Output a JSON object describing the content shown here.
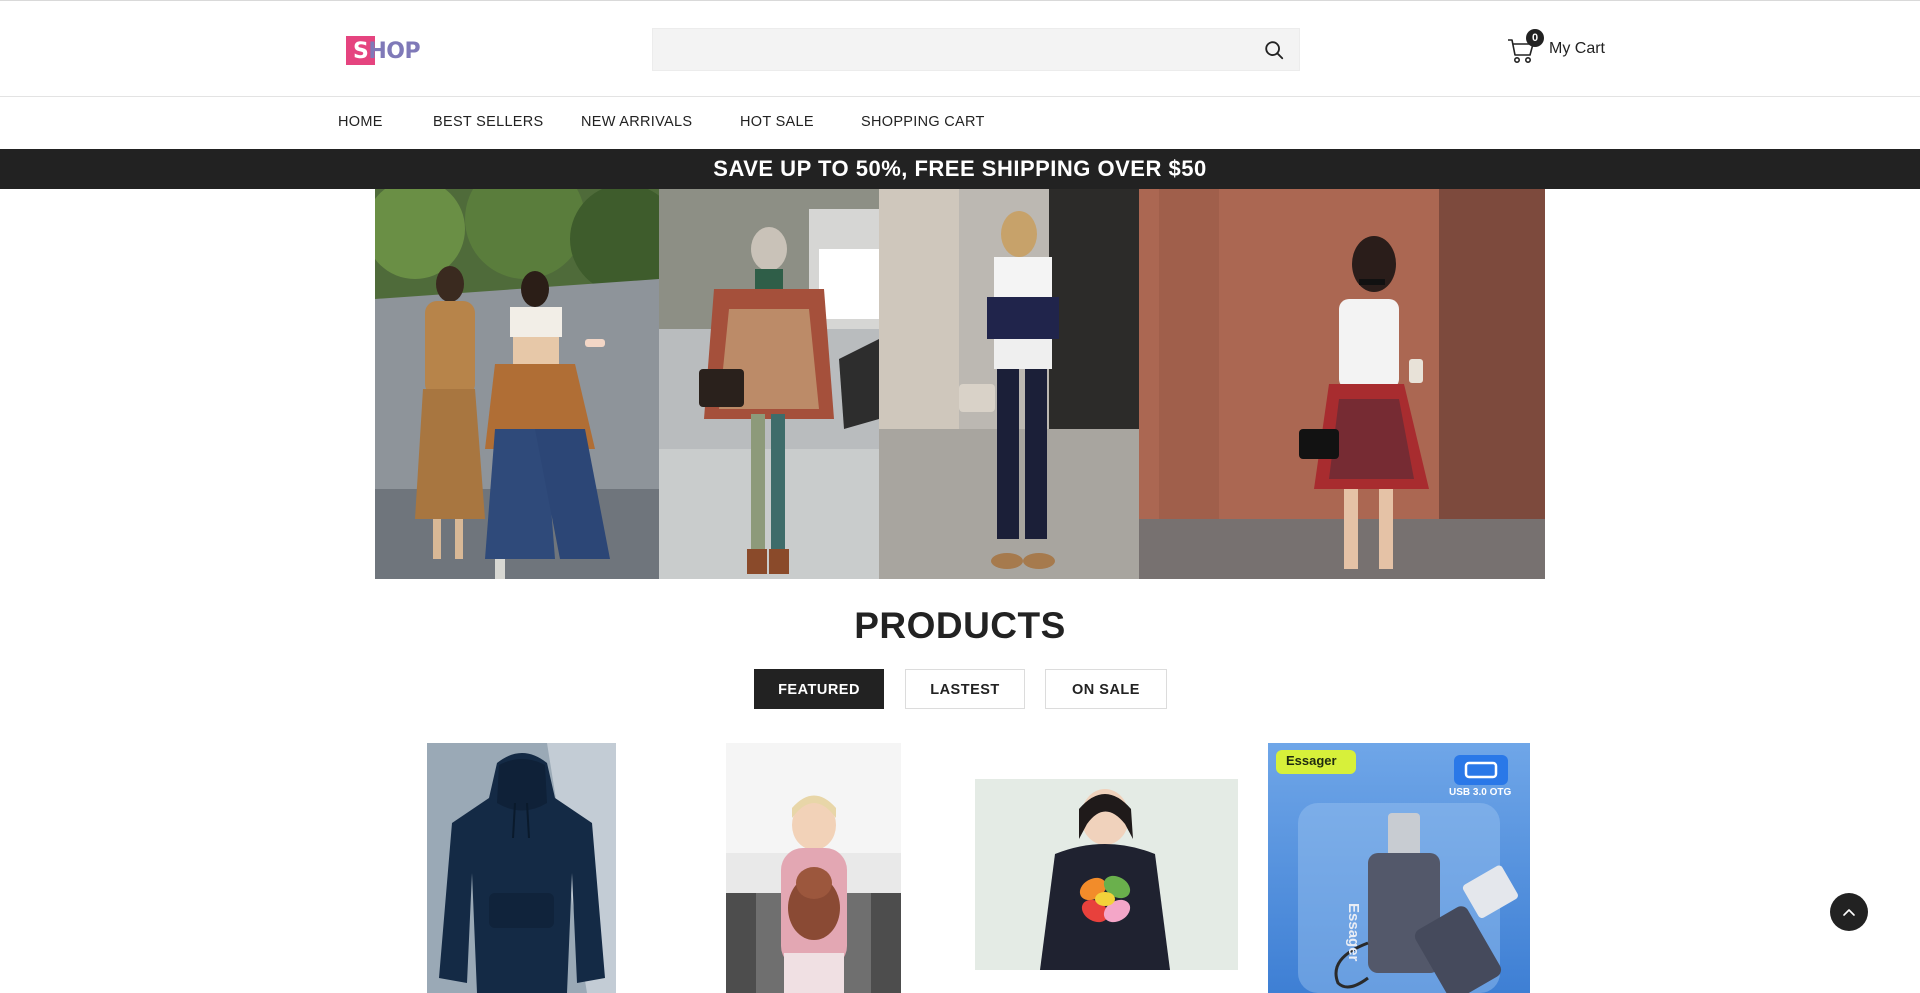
{
  "header": {
    "logo": {
      "first_letter": "S",
      "rest": "HOP"
    },
    "search": {
      "placeholder": "",
      "value": ""
    },
    "cart": {
      "count": "0",
      "label": "My Cart"
    }
  },
  "nav": {
    "items": [
      {
        "label": "HOME"
      },
      {
        "label": "BEST SELLERS"
      },
      {
        "label": "NEW ARRIVALS"
      },
      {
        "label": "HOT SALE"
      },
      {
        "label": "SHOPPING CART"
      }
    ]
  },
  "promo": {
    "text": "SAVE UP TO 50%, FREE SHIPPING OVER $50"
  },
  "products": {
    "title": "PRODUCTS",
    "tabs": [
      {
        "label": "FEATURED",
        "active": true
      },
      {
        "label": "LASTEST",
        "active": false
      },
      {
        "label": "ON SALE",
        "active": false
      }
    ],
    "item4": {
      "brand_tag": "Essager",
      "usb_label": "USB 3.0 OTG",
      "product_brand": "Essager"
    }
  },
  "colors": {
    "logo_accent": "#e5447f",
    "logo_text": "#7f79b8",
    "dark": "#222222",
    "promo_bg": "#222222"
  }
}
